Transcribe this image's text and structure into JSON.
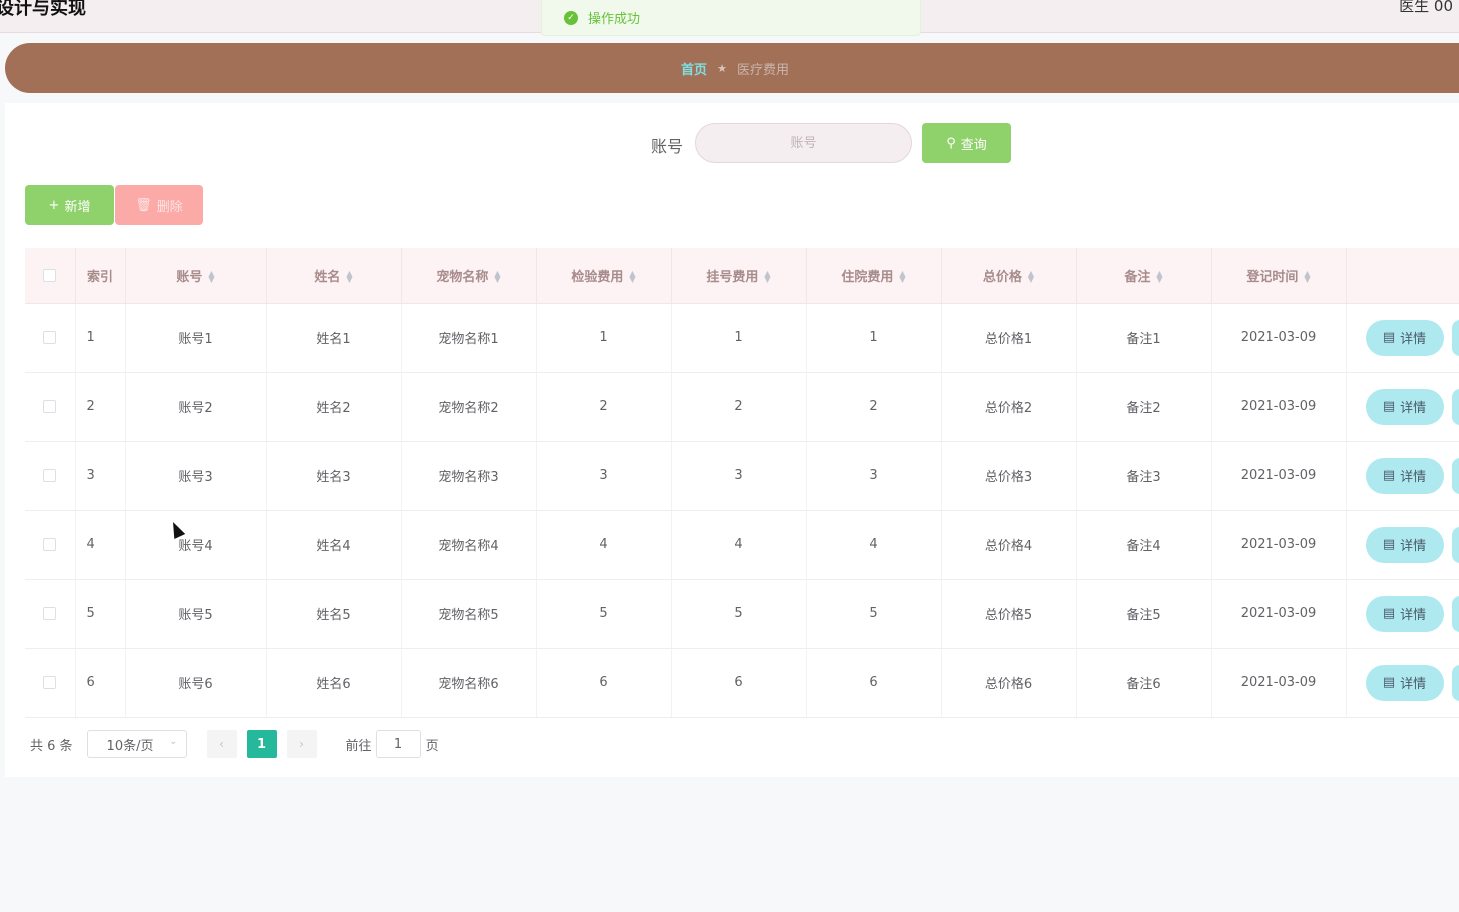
{
  "header": {
    "title": "设计与实现",
    "user": "医生 00"
  },
  "toast": {
    "message": "操作成功"
  },
  "breadcrumb": {
    "home": "首页",
    "separator": "★",
    "current": "医疗费用"
  },
  "search": {
    "label": "账号",
    "placeholder": "账号",
    "value": "",
    "button": "查询"
  },
  "actions": {
    "add": "新增",
    "delete": "删除"
  },
  "table": {
    "headers": {
      "index": "索引",
      "account": "账号",
      "name": "姓名",
      "pet": "宠物名称",
      "exam": "检验费用",
      "reg": "挂号费用",
      "stay": "住院费用",
      "total": "总价格",
      "note": "备注",
      "time": "登记时间"
    },
    "detail_label": "详情",
    "rows": [
      {
        "index": "1",
        "account": "账号1",
        "name": "姓名1",
        "pet": "宠物名称1",
        "exam": "1",
        "reg": "1",
        "stay": "1",
        "total": "总价格1",
        "note": "备注1",
        "time": "2021-03-09"
      },
      {
        "index": "2",
        "account": "账号2",
        "name": "姓名2",
        "pet": "宠物名称2",
        "exam": "2",
        "reg": "2",
        "stay": "2",
        "total": "总价格2",
        "note": "备注2",
        "time": "2021-03-09"
      },
      {
        "index": "3",
        "account": "账号3",
        "name": "姓名3",
        "pet": "宠物名称3",
        "exam": "3",
        "reg": "3",
        "stay": "3",
        "total": "总价格3",
        "note": "备注3",
        "time": "2021-03-09"
      },
      {
        "index": "4",
        "account": "账号4",
        "name": "姓名4",
        "pet": "宠物名称4",
        "exam": "4",
        "reg": "4",
        "stay": "4",
        "total": "总价格4",
        "note": "备注4",
        "time": "2021-03-09"
      },
      {
        "index": "5",
        "account": "账号5",
        "name": "姓名5",
        "pet": "宠物名称5",
        "exam": "5",
        "reg": "5",
        "stay": "5",
        "total": "总价格5",
        "note": "备注5",
        "time": "2021-03-09"
      },
      {
        "index": "6",
        "account": "账号6",
        "name": "姓名6",
        "pet": "宠物名称6",
        "exam": "6",
        "reg": "6",
        "stay": "6",
        "total": "总价格6",
        "note": "备注6",
        "time": "2021-03-09"
      }
    ]
  },
  "pagination": {
    "total": "共 6 条",
    "page_size": "10条/页",
    "current": "1",
    "goto_label": "前往",
    "goto_value": "1",
    "page_unit": "页"
  },
  "colors": {
    "accent_green": "#8fd16a",
    "brown_bar": "#a26f57",
    "page_active": "#26b89a",
    "detail_button": "#aee9ef",
    "delete_button": "#fcaaa8"
  },
  "icons": {
    "toast": "check-circle-icon",
    "add": "plus-icon",
    "delete": "trash-icon",
    "search": "search-icon",
    "detail": "document-icon"
  }
}
